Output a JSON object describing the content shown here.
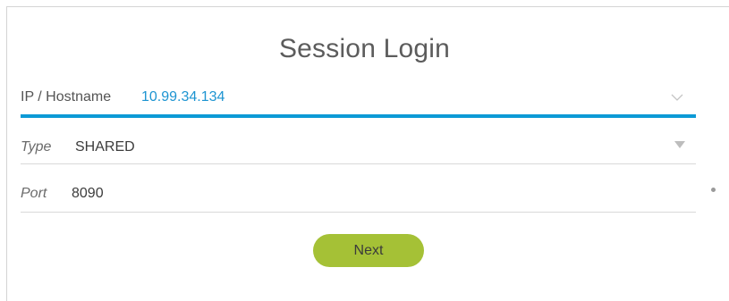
{
  "form": {
    "title": "Session Login",
    "ip_field": {
      "label": "IP / Hostname",
      "value": "10.99.34.134",
      "icon": "chevron-down-icon"
    },
    "type_field": {
      "label": "Type",
      "value": "SHARED",
      "icon": "caret-down-icon"
    },
    "port_field": {
      "label": "Port",
      "value": "8090",
      "required_marker_icon": "dot-icon"
    },
    "next_button": {
      "label": "Next"
    }
  },
  "colors": {
    "accent": "#0c9ad6",
    "button": "#a5c136",
    "title": "#5c5c5c"
  }
}
